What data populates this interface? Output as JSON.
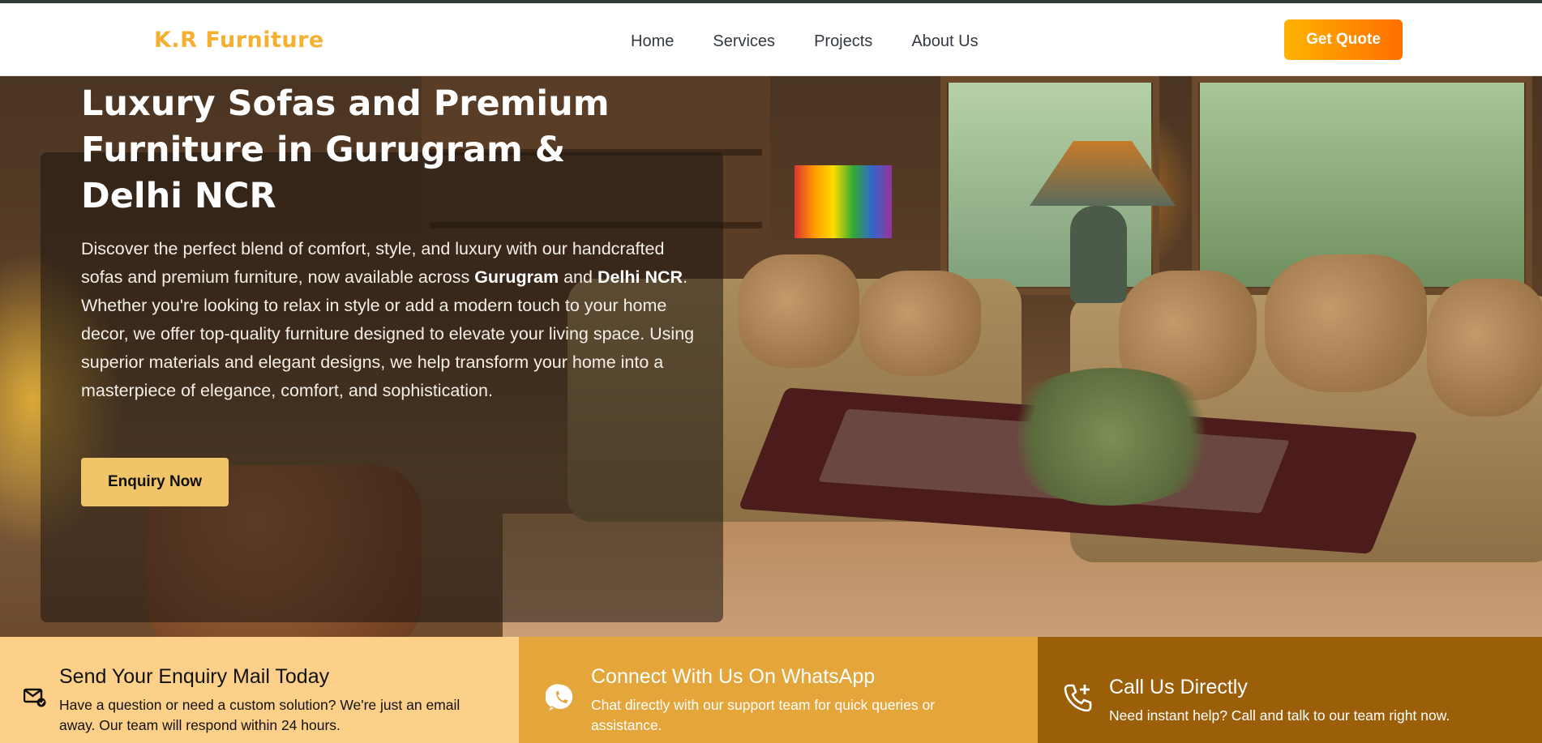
{
  "header": {
    "logo": "K.R Furniture",
    "nav": [
      "Home",
      "Services",
      "Projects",
      "About Us"
    ],
    "cta": "Get Quote"
  },
  "hero": {
    "title": "Luxury Sofas and Premium Furniture in Gurugram & Delhi NCR",
    "description": {
      "part1": "Discover the perfect blend of comfort, style, and luxury with our handcrafted sofas and premium furniture, now available across ",
      "bold1": "Gurugram",
      "part2": " and ",
      "bold2": "Delhi NCR",
      "part3": ". Whether you're looking to relax in style or add a modern touch to your home decor, we offer top-quality furniture designed to elevate your living space. Using superior materials and elegant designs, we help transform your home into a masterpiece of elegance, comfort, and sophistication."
    },
    "button": "Enquiry Now"
  },
  "cards": [
    {
      "title": "Send Your Enquiry Mail Today",
      "text": "Have a question or need a custom solution? We're just an email away. Our team will respond within 24 hours.",
      "icon": "mail-icon",
      "background": "#fdd089"
    },
    {
      "title": "Connect With Us On WhatsApp",
      "text": "Chat directly with our support team for quick queries or assistance.",
      "icon": "whatsapp-icon",
      "background": "#e4a53b"
    },
    {
      "title": "Call Us Directly",
      "text": "Need instant help? Call and talk to our team right now.",
      "icon": "phone-add-icon",
      "background": "#9b5f0a"
    }
  ],
  "colors": {
    "logo": "#f6b030",
    "cta_gradient_start": "#ffb300",
    "cta_gradient_end": "#ff6f00",
    "enquiry_button": "#f2c46a"
  }
}
